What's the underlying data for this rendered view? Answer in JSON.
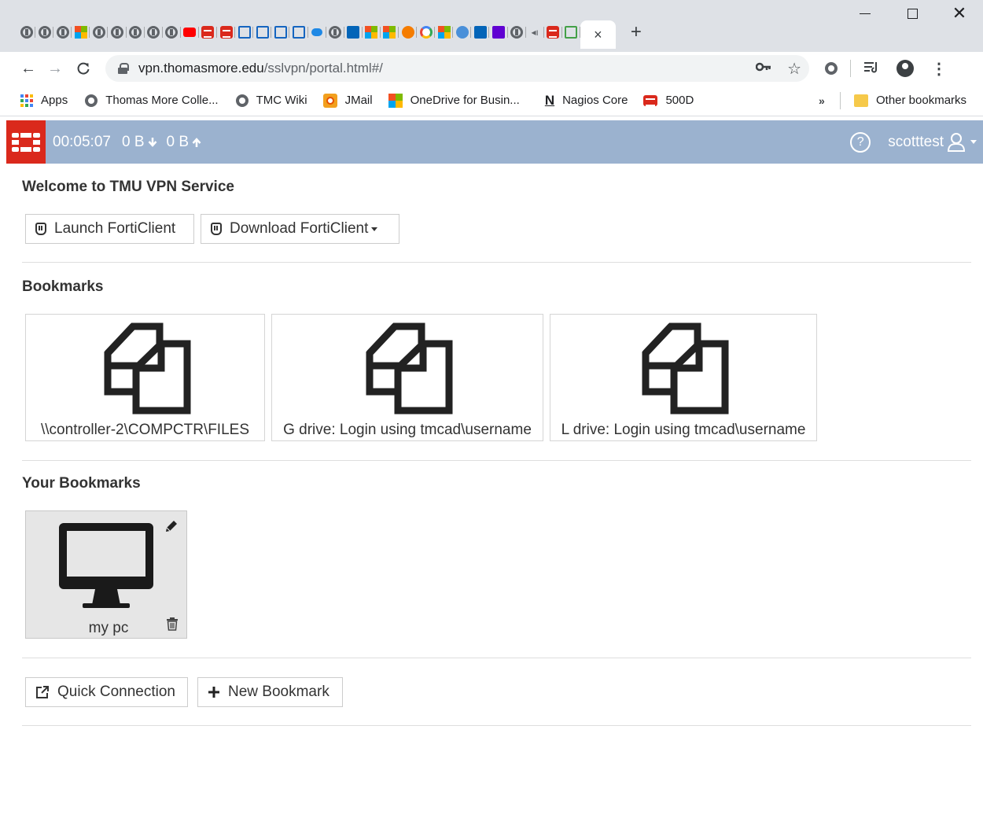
{
  "browser": {
    "pinned_tabs": [
      "globe",
      "globe",
      "globe",
      "ms",
      "globe",
      "globe",
      "globe",
      "globe",
      "globe",
      "yt",
      "forti",
      "forti",
      "sq",
      "sq",
      "sq",
      "sq",
      "cloud",
      "globe",
      "outlook",
      "ms",
      "ms",
      "orange",
      "g",
      "ms",
      "blue",
      "outlook",
      "purple",
      "globe",
      "speaker",
      "forti",
      "green"
    ],
    "active_tab_close": "×",
    "new_tab": "+",
    "window_controls": {
      "minimize": "",
      "maximize": "",
      "close": "✕"
    },
    "nav": {
      "back": "←",
      "forward": "→",
      "reload": "C"
    },
    "url_host": "vpn.thomasmore.edu",
    "url_path": "/sslvpn/portal.html#/",
    "omnibox_icons": {
      "key": "O┳",
      "star": "☆"
    },
    "menu": "⋮",
    "bookmarks_bar": [
      {
        "label": "Apps",
        "icon": "apps-icon"
      },
      {
        "label": "Thomas More Colle...",
        "icon": "globe-icon"
      },
      {
        "label": "TMC Wiki",
        "icon": "globe-icon"
      },
      {
        "label": "JMail",
        "icon": "outlook-icon"
      },
      {
        "label": "OneDrive for Busin...",
        "icon": "microsoft-icon"
      },
      {
        "label": "Nagios Core",
        "icon": "nagios-icon"
      },
      {
        "label": "500D",
        "icon": "fortinet-icon"
      }
    ],
    "bookmarks_more": "»",
    "other_bookmarks": "Other bookmarks"
  },
  "portal": {
    "session_time": "00:05:07",
    "bytes_in": "0 B",
    "bytes_out": "0 B",
    "help": "?",
    "username": "scotttest",
    "welcome_title": "Welcome to TMU VPN Service",
    "launch_label": "Launch FortiClient",
    "download_label": "Download FortiClient",
    "bookmarks_title": "Bookmarks",
    "bookmarks": [
      {
        "label": "\\\\controller-2\\COMPCTR\\FILES"
      },
      {
        "label": "G drive: Login using tmcad\\username"
      },
      {
        "label": "L drive: Login using tmcad\\username"
      }
    ],
    "your_bookmarks_title": "Your Bookmarks",
    "your_bookmarks": [
      {
        "label": "my pc"
      }
    ],
    "quick_connection_label": "Quick Connection",
    "new_bookmark_label": "New Bookmark"
  },
  "colors": {
    "portal_bar": "#9bb2cf",
    "fortinet_red": "#da291c",
    "tab_strip": "#dee1e6"
  }
}
